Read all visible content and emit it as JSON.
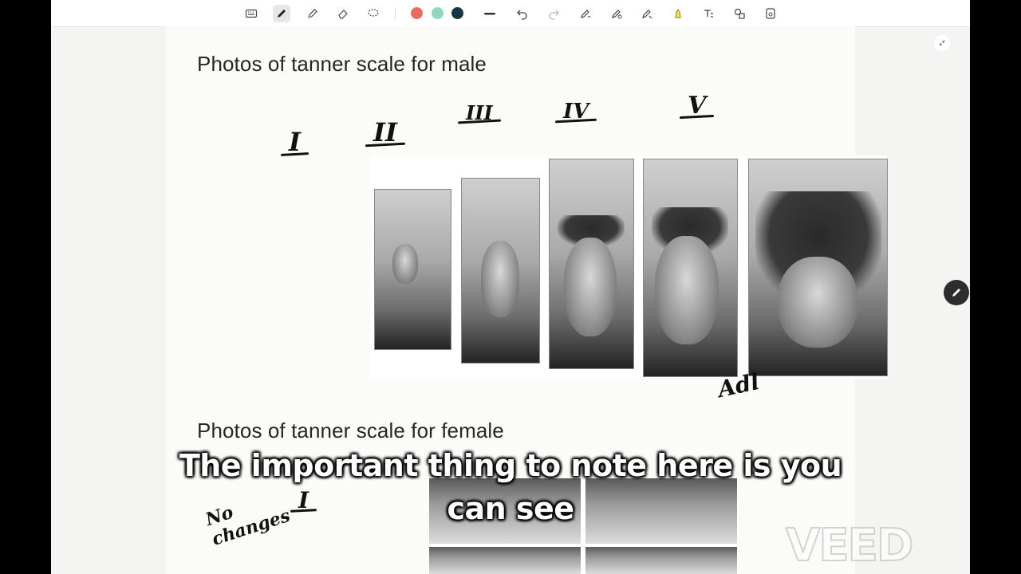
{
  "toolbar": {
    "tools": [
      "keyboard-icon",
      "pen-icon",
      "highlighter-icon",
      "eraser-icon",
      "lasso-icon"
    ],
    "colors": [
      "#e96b63",
      "#92d5c1",
      "#173540"
    ],
    "actions": [
      "stroke-width-icon",
      "undo-icon",
      "redo-icon",
      "text-select-icon",
      "shape-icon",
      "pen-mode-icon",
      "highlight-icon",
      "text-box-icon",
      "shapes-icon",
      "image-icon"
    ]
  },
  "canvas": {
    "heading_male": "Photos of tanner scale for male",
    "heading_female": "Photos of tanner scale for female",
    "stages": [
      "I",
      "II",
      "III",
      "IV",
      "V"
    ],
    "annotation_adult": "Adl",
    "annotation_no_changes": "No changes",
    "annotation_female_stage": "I"
  },
  "subtitle": {
    "line1": "The important thing to note here is you",
    "line2": "can see"
  },
  "watermark": "VEED"
}
